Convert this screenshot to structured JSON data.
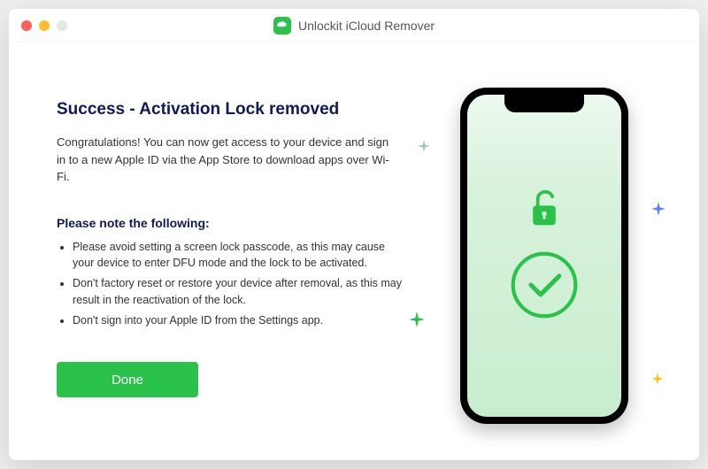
{
  "window": {
    "title": "Unlockit iCloud Remover"
  },
  "main": {
    "heading": "Success - Activation Lock removed",
    "description": "Congratulations! You can now get access to your device and sign in to a new Apple ID via the App Store to download apps over Wi-Fi.",
    "note_heading": "Please note the following:",
    "notes": [
      "Please avoid setting a screen lock passcode, as this may cause your device to enter DFU mode and the lock to be activated.",
      "Don't factory reset or restore your device after removal, as this may result in the reactivation of the lock.",
      "Don't sign into your Apple ID from the Settings app."
    ],
    "done_label": "Done"
  },
  "colors": {
    "primary_green": "#2ac24a",
    "heading_navy": "#0f1a57"
  }
}
